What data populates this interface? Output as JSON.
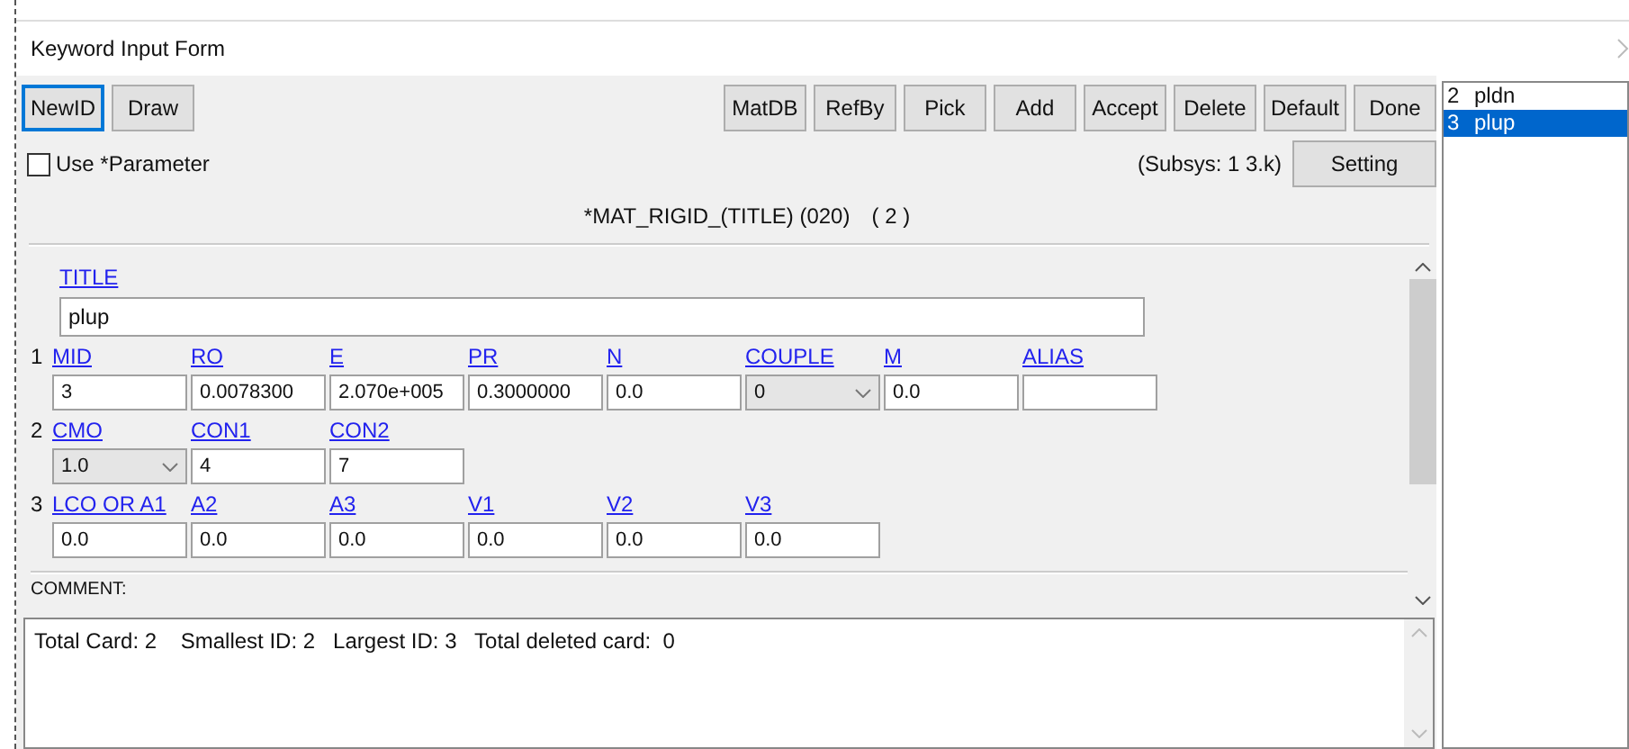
{
  "window": {
    "title": "Keyword Input Form"
  },
  "toolbar": {
    "left_buttons": [
      {
        "label": "NewID",
        "focused": true
      },
      {
        "label": "Draw",
        "focused": false
      }
    ],
    "right_buttons": [
      {
        "label": "MatDB"
      },
      {
        "label": "RefBy"
      },
      {
        "label": "Pick"
      },
      {
        "label": "Add"
      },
      {
        "label": "Accept"
      },
      {
        "label": "Delete"
      },
      {
        "label": "Default"
      },
      {
        "label": "Done"
      }
    ]
  },
  "use_parameter": {
    "label": "Use *Parameter",
    "checked": false
  },
  "subsys": "(Subsys: 1 3.k)",
  "setting_button": "Setting",
  "keyword_header": "*MAT_RIGID_(TITLE) (020)",
  "keyword_count": "( 2 )",
  "title_field": {
    "label": "TITLE",
    "value": "plup"
  },
  "cards": [
    {
      "number": "1",
      "fields": [
        {
          "label": "MID",
          "kind": "input",
          "value": "3"
        },
        {
          "label": "RO",
          "kind": "input",
          "value": "0.0078300"
        },
        {
          "label": "E",
          "kind": "input",
          "value": "2.070e+005"
        },
        {
          "label": "PR",
          "kind": "input",
          "value": "0.3000000"
        },
        {
          "label": "N",
          "kind": "input",
          "value": "0.0"
        },
        {
          "label": "COUPLE",
          "kind": "select",
          "value": "0"
        },
        {
          "label": "M",
          "kind": "input",
          "value": "0.0"
        },
        {
          "label": "ALIAS",
          "kind": "input"
        }
      ]
    },
    {
      "number": "2",
      "fields": [
        {
          "label": "CMO",
          "kind": "select",
          "value": "1.0"
        },
        {
          "label": "CON1",
          "kind": "input",
          "value": "4"
        },
        {
          "label": "CON2",
          "kind": "input",
          "value": "7"
        }
      ]
    },
    {
      "number": "3",
      "fields": [
        {
          "label": "LCO OR A1",
          "kind": "input",
          "value": "0.0"
        },
        {
          "label": "A2",
          "kind": "input",
          "value": "0.0"
        },
        {
          "label": "A3",
          "kind": "input",
          "value": "0.0"
        },
        {
          "label": "V1",
          "kind": "input",
          "value": "0.0"
        },
        {
          "label": "V2",
          "kind": "input",
          "value": "0.0"
        },
        {
          "label": "V3",
          "kind": "input",
          "value": "0.0"
        }
      ]
    }
  ],
  "comment_label": "COMMENT:",
  "summary": "Total Card: 2    Smallest ID: 2   Largest ID: 3   Total deleted card:  0",
  "id_list": [
    {
      "id": "2",
      "name": "pldn",
      "selected": false
    },
    {
      "id": "3",
      "name": "plup",
      "selected": true
    }
  ]
}
